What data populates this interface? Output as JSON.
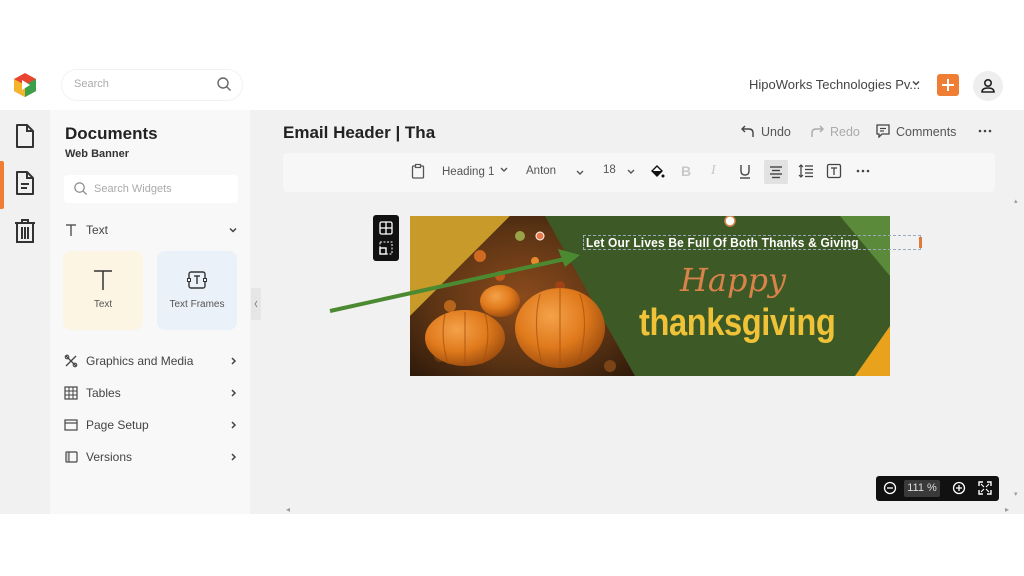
{
  "topbar": {
    "search_placeholder": "Search",
    "organization": "HipoWorks Technologies Pv...",
    "icons": {
      "logo": "app-logo",
      "search": "search-icon",
      "org_chevron": "chevron-down-icon",
      "add": "plus-icon",
      "account": "user-icon"
    }
  },
  "rail": {
    "items": [
      {
        "name": "documents",
        "icon": "file-icon",
        "active": false
      },
      {
        "name": "document-text",
        "icon": "file-text-icon",
        "active": true
      },
      {
        "name": "trash",
        "icon": "trash-icon",
        "active": false
      }
    ],
    "accent_color": "#ef7d33"
  },
  "panel": {
    "title": "Documents",
    "subtitle": "Web Banner",
    "search_placeholder": "Search Widgets",
    "text_section": {
      "label": "Text",
      "expanded": true
    },
    "cards": [
      {
        "label": "Text",
        "icon": "text-icon",
        "bg": "#fdf5e3"
      },
      {
        "label": "Text Frames",
        "icon": "text-frame-icon",
        "bg": "#eaf1f9"
      }
    ],
    "sections": [
      {
        "label": "Graphics and Media",
        "icon": "graphics-icon"
      },
      {
        "label": "Tables",
        "icon": "table-icon"
      },
      {
        "label": "Page Setup",
        "icon": "page-setup-icon"
      },
      {
        "label": "Versions",
        "icon": "versions-icon"
      }
    ]
  },
  "header": {
    "doc_title": "Email Header | Tha",
    "undo_label": "Undo",
    "redo_label": "Redo",
    "comments_label": "Comments"
  },
  "toolbar": {
    "paragraph_style": "Heading 1",
    "font_family": "Anton",
    "font_size": "18",
    "tools": [
      "paste",
      "fill-color",
      "bold",
      "italic",
      "underline",
      "align-center",
      "line-spacing",
      "text-box",
      "more"
    ],
    "active_tool": "align-center"
  },
  "banner": {
    "tagline": "Let Our Lives Be Full Of Both Thanks & Giving",
    "script_word": "Happy",
    "main_word": "thanksgiving",
    "colors": {
      "green": "#3d5a26",
      "light_green": "#5a8a3a",
      "gold": "#e8a21c",
      "mustard": "#c89a2a",
      "tagline": "#ffffff",
      "script": "#d9824a",
      "main": "#f0c237"
    }
  },
  "zoom": {
    "value": "111 %"
  }
}
